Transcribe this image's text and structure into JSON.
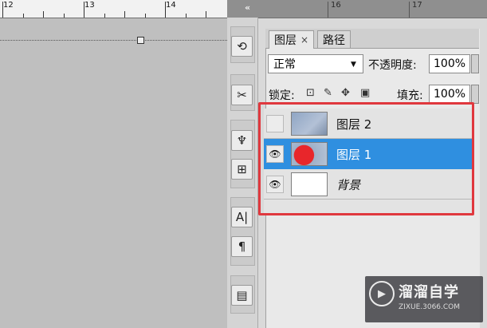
{
  "ruler": {
    "labels": [
      "12",
      "13",
      "14",
      "16",
      "17"
    ]
  },
  "tabs": {
    "layers": "图层",
    "close": "×",
    "paths": "路径"
  },
  "blend": {
    "mode": "正常"
  },
  "opacity": {
    "label": "不透明度:",
    "value": "100%"
  },
  "lock": {
    "label": "锁定:"
  },
  "fill": {
    "label": "填充:",
    "value": "100%"
  },
  "layers": [
    {
      "name": "图层 2",
      "visible": false,
      "selected": false
    },
    {
      "name": "图层 1",
      "visible": true,
      "selected": true
    },
    {
      "name": "背景",
      "visible": true,
      "selected": false
    }
  ],
  "colors": {
    "selected_row": "#2f8fe0",
    "highlight_box": "#e0383e",
    "selected_text": "#ffffff"
  },
  "watermark": {
    "title": "溜溜自学",
    "url": "ZIXUE.3066.COM"
  }
}
